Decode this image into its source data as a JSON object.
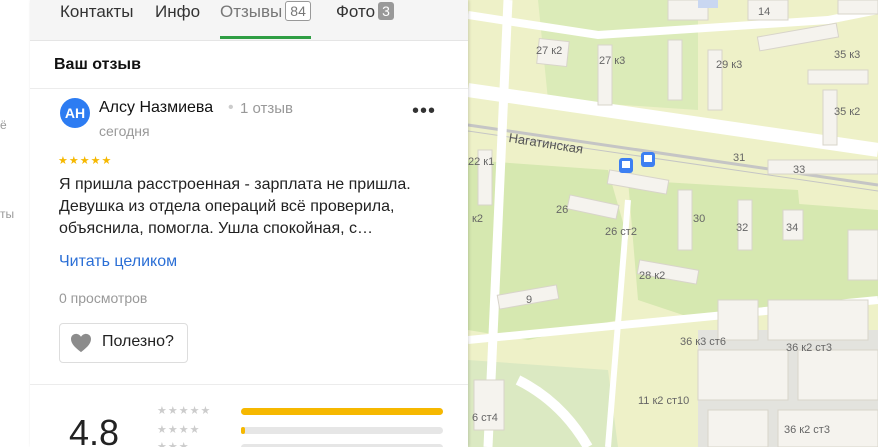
{
  "rail": {
    "labels": [
      "ё",
      "ты"
    ]
  },
  "tabs": [
    {
      "label": "Контакты"
    },
    {
      "label": "Инфо"
    },
    {
      "label": "Отзывы",
      "count": "84"
    },
    {
      "label": "Фото",
      "count": "3"
    }
  ],
  "section_title": "Ваш отзыв",
  "review": {
    "avatar_initials": "АН",
    "author": "Алсу Назмиева",
    "separator": "•",
    "reviews_count": "1 отзыв",
    "date": "сегодня",
    "stars": "★★★★★",
    "text": "Я пришла расстроенная - зарплата не пришла. Девушка из отдела операций всё проверила, объяснила, помогла. Ушла спокойная, с…",
    "read_more": "Читать целиком",
    "views": "0 просмотров",
    "useful_label": "Полезно?",
    "more_label": "•••"
  },
  "summary": {
    "rating": "4.8",
    "bars": [
      {
        "stars": "★★★★★",
        "fraction": 1.0
      },
      {
        "stars": "★★★★",
        "fraction": 0.02
      },
      {
        "stars": "★★★",
        "fraction": 0.0
      }
    ]
  },
  "map": {
    "street": "Нагатинская",
    "labels": [
      "14",
      "27 к2",
      "27 к3",
      "29 к3",
      "35 к3",
      "35 к2",
      "22 к1",
      "31",
      "33",
      "26",
      "26 ст2",
      "30",
      "32",
      "34",
      "28 к2",
      "9",
      "36 к3 ст6",
      "36 к2 ст3",
      "6 ст4",
      "11 к2 ст10",
      "36 к2 ст3",
      "к2"
    ],
    "colors": {
      "land": "#eef1c8",
      "park": "#d6e8b0",
      "building": "#f5f3ee",
      "road": "#ffffff",
      "rail": "#c5c5c5"
    }
  }
}
